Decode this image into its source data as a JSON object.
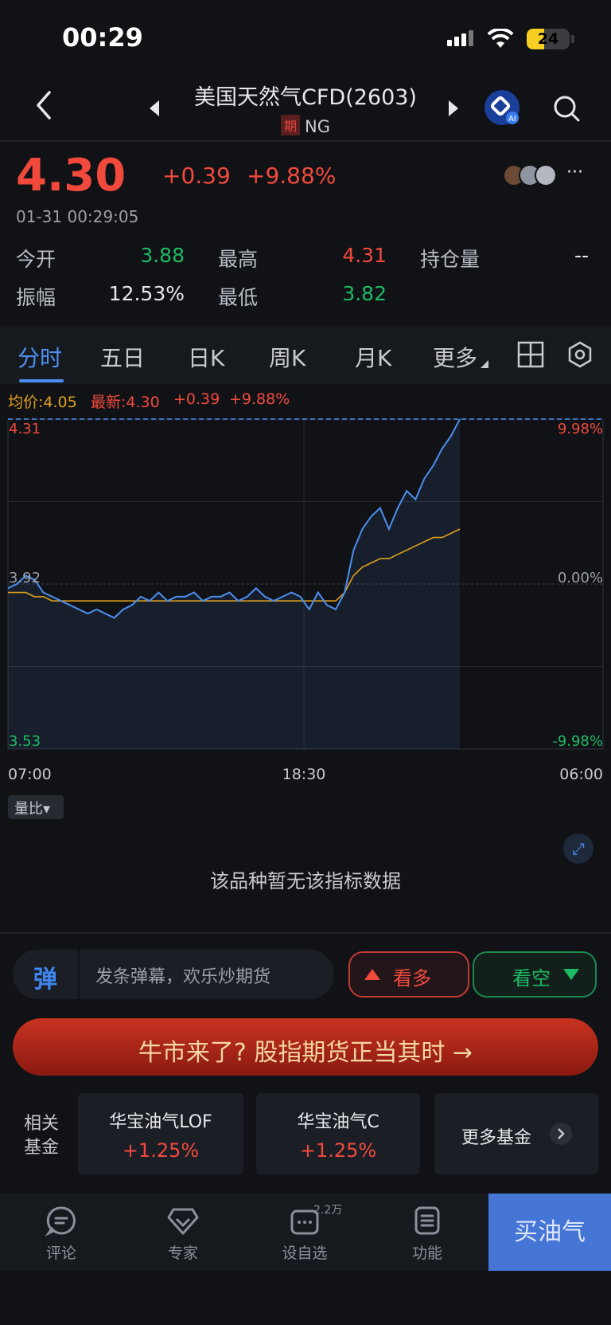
{
  "status": {
    "time": "00:29",
    "battery": "24"
  },
  "header": {
    "title": "美国天然气CFD(2603)",
    "badge": "期",
    "symbol": "NG"
  },
  "quote": {
    "price": "4.30",
    "change": "+0.39",
    "change_pct": "+9.88%",
    "time": "01-31 00:29:05",
    "more": "···"
  },
  "stats": [
    {
      "label": "今开",
      "value": "3.88",
      "color": "green"
    },
    {
      "label": "最高",
      "value": "4.31",
      "color": "red"
    },
    {
      "label": "持仓量",
      "value": "--",
      "color": "white"
    },
    {
      "label": "振幅",
      "value": "12.53%",
      "color": "white"
    },
    {
      "label": "最低",
      "value": "3.82",
      "color": "green"
    }
  ],
  "tabs": [
    "分时",
    "五日",
    "日K",
    "周K",
    "月K",
    "更多"
  ],
  "legend": {
    "avg": "均价:4.05",
    "latest": "最新:4.30",
    "chg": "+0.39",
    "pct": "+9.88%"
  },
  "chart_data": {
    "type": "line",
    "x_ticks": [
      "07:00",
      "18:30",
      "06:00"
    ],
    "y_ticks_left": [
      "4.31",
      "3.92",
      "3.53"
    ],
    "y_ticks_right": [
      "9.98%",
      "0.00%",
      "-9.98%"
    ],
    "ylim": [
      3.53,
      4.31
    ],
    "series": [
      {
        "name": "最新",
        "color": "#4d8ff0",
        "values": [
          3.91,
          3.92,
          3.94,
          3.93,
          3.9,
          3.89,
          3.88,
          3.87,
          3.86,
          3.85,
          3.86,
          3.85,
          3.84,
          3.86,
          3.87,
          3.89,
          3.88,
          3.9,
          3.88,
          3.89,
          3.89,
          3.9,
          3.88,
          3.89,
          3.89,
          3.9,
          3.88,
          3.89,
          3.91,
          3.89,
          3.88,
          3.89,
          3.9,
          3.89,
          3.86,
          3.9,
          3.87,
          3.86,
          3.9,
          4.0,
          4.05,
          4.08,
          4.1,
          4.05,
          4.1,
          4.14,
          4.12,
          4.17,
          4.2,
          4.24,
          4.27,
          4.31
        ]
      },
      {
        "name": "均价",
        "color": "#e0a01c",
        "values": [
          3.9,
          3.9,
          3.9,
          3.89,
          3.89,
          3.88,
          3.88,
          3.88,
          3.88,
          3.88,
          3.88,
          3.88,
          3.88,
          3.88,
          3.88,
          3.88,
          3.88,
          3.88,
          3.88,
          3.88,
          3.88,
          3.88,
          3.88,
          3.88,
          3.88,
          3.88,
          3.88,
          3.88,
          3.88,
          3.88,
          3.88,
          3.88,
          3.88,
          3.88,
          3.88,
          3.88,
          3.88,
          3.88,
          3.9,
          3.94,
          3.96,
          3.97,
          3.98,
          3.98,
          3.99,
          4.0,
          4.01,
          4.02,
          4.03,
          4.03,
          4.04,
          4.05
        ]
      }
    ]
  },
  "indicator": {
    "label": "量比▾",
    "empty": "该品种暂无该指标数据"
  },
  "danmu": {
    "icon": "弹",
    "placeholder": "发条弹幕，欢乐炒期货"
  },
  "sentiment": {
    "bull": "看多",
    "bear": "看空"
  },
  "banner": {
    "text": "牛市来了? 股指期货正当其时 →"
  },
  "funds": {
    "label": "相关基金",
    "items": [
      {
        "name": "华宝油气LOF",
        "pct": "+1.25%"
      },
      {
        "name": "华宝油气C",
        "pct": "+1.25%"
      }
    ],
    "more": "更多基金"
  },
  "bottom_nav": {
    "items": [
      {
        "label": "评论",
        "icon": "comment-icon"
      },
      {
        "label": "专家",
        "icon": "expert-icon"
      },
      {
        "label": "设自选",
        "icon": "watchlist-icon",
        "badge": "2.2万"
      },
      {
        "label": "功能",
        "icon": "function-icon"
      }
    ],
    "buy": "买油气"
  }
}
